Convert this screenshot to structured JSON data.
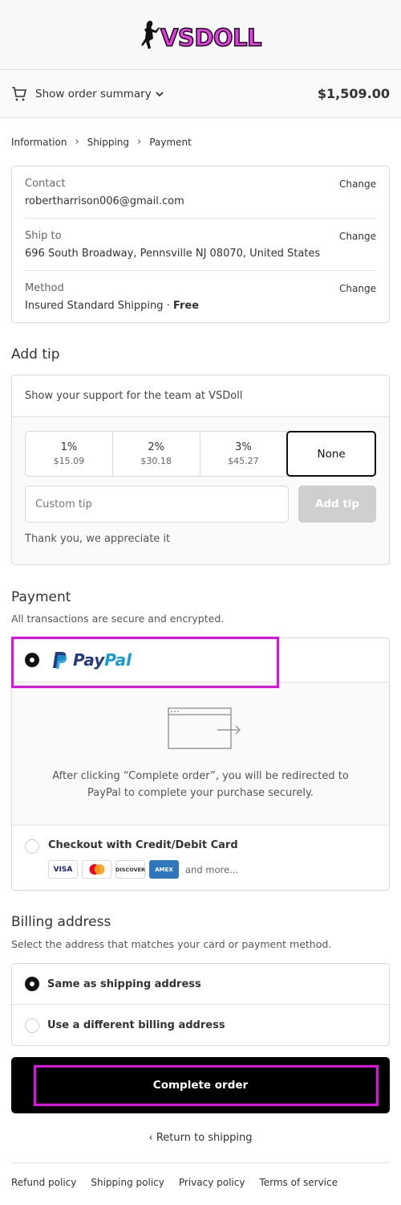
{
  "header": {
    "logo_text": "VSDOLL"
  },
  "summary": {
    "label": "Show order summary",
    "total": "$1,509.00"
  },
  "breadcrumb": [
    "Information",
    "Shipping",
    "Payment"
  ],
  "review": {
    "contact": {
      "label": "Contact",
      "value": "robertharrison006@gmail.com",
      "change": "Change"
    },
    "ship_to": {
      "label": "Ship to",
      "value": "696 South Broadway, Pennsville NJ 08070, United States",
      "change": "Change"
    },
    "method": {
      "label": "Method",
      "value": "Insured Standard Shipping · ",
      "value_bold": "Free",
      "change": "Change"
    }
  },
  "tip": {
    "title": "Add tip",
    "support_text": "Show your support for the team at VSDoll",
    "options": [
      {
        "pct": "1%",
        "amount": "$15.09"
      },
      {
        "pct": "2%",
        "amount": "$30.18"
      },
      {
        "pct": "3%",
        "amount": "$45.27"
      }
    ],
    "none_label": "None",
    "custom_placeholder": "Custom tip",
    "add_button": "Add tip",
    "thanks": "Thank you, we appreciate it"
  },
  "payment": {
    "title": "Payment",
    "subtitle": "All transactions are secure and encrypted.",
    "paypal_part1": "Pay",
    "paypal_part2": "Pal",
    "redirect_text": "After clicking “Complete order”, you will be redirected to PayPal to complete your purchase securely.",
    "card_option": "Checkout with Credit/Debit Card",
    "card_logos": [
      "VISA",
      "",
      "DISCOVER",
      "AMEX"
    ],
    "and_more": "and more..."
  },
  "billing": {
    "title": "Billing address",
    "subtitle": "Select the address that matches your card or payment method.",
    "same": "Same as shipping address",
    "different": "Use a different billing address"
  },
  "complete_button": "Complete order",
  "return_link": "Return to shipping",
  "footer": [
    "Refund policy",
    "Shipping policy",
    "Privacy policy",
    "Terms of service"
  ],
  "colors": {
    "highlight": "#e40de8",
    "logo": "#e83ce6",
    "paypal_dark": "#253b80",
    "paypal_light": "#179bd7"
  }
}
